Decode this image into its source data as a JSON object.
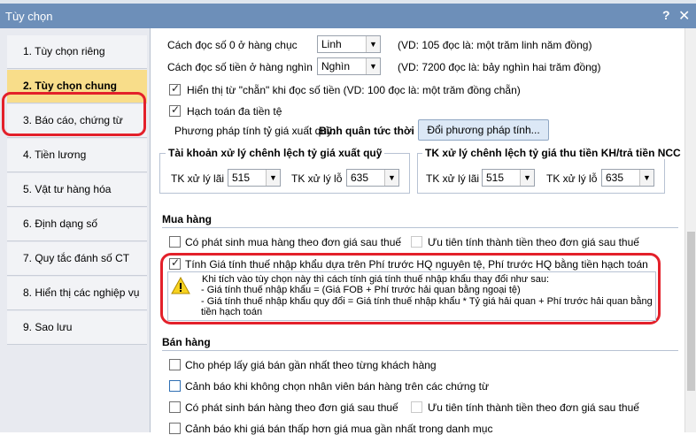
{
  "window": {
    "title": "Tùy chọn",
    "help": "?",
    "close": "✕"
  },
  "sidebar": {
    "items": [
      {
        "label": "1. Tùy chọn riêng"
      },
      {
        "label": "2. Tùy chọn chung"
      },
      {
        "label": "3. Báo cáo, chứng từ"
      },
      {
        "label": "4. Tiền lương"
      },
      {
        "label": "5. Vật tư hàng hóa"
      },
      {
        "label": "6. Định dạng số"
      },
      {
        "label": "7. Quy tắc đánh số CT"
      },
      {
        "label": "8. Hiển thị các nghiệp vụ"
      },
      {
        "label": "9. Sao lưu"
      }
    ]
  },
  "reading": {
    "row1_label": "Cách đọc số 0 ở hàng chục",
    "row1_value": "Linh",
    "row1_example": "(VD: 105 đọc là: một trăm linh năm đồng)",
    "row2_label": "Cách đọc số tiền ở hàng nghìn",
    "row2_value": "Nghìn",
    "row2_example": "(VD: 7200 đọc là: bảy nghìn hai trăm đồng)",
    "show_chan": "Hiển thị từ \"chẵn\" khi đọc số tiền (VD: 100 đọc là: một trăm đồng chẵn)",
    "multi_currency": "Hạch toán đa tiền tệ",
    "rate_method_label": "Phương pháp tính tỷ giá xuất quỹ:",
    "rate_method_value": "Bình quân tức thời",
    "change_method_button": "Đổi phương pháp tính..."
  },
  "group_left": {
    "title": "Tài khoản xử lý chênh lệch tỷ giá xuất quỹ",
    "gain_label": "TK xử lý lãi",
    "gain_value": "515",
    "loss_label": "TK xử lý lỗ",
    "loss_value": "635"
  },
  "group_right": {
    "title": "TK xử lý chênh lệch tỷ giá thu tiền KH/trả tiền NCC",
    "gain_label": "TK xử lý lãi",
    "gain_value": "515",
    "loss_label": "TK xử lý lỗ",
    "loss_value": "635"
  },
  "purchase": {
    "title": "Mua hàng",
    "opt1": "Có phát sinh mua hàng theo đơn giá sau thuế",
    "opt2": "Ưu tiên tính thành tiền theo đơn giá sau thuế",
    "opt3": "Tính Giá tính thuế nhập khẩu dựa trên Phí trước HQ nguyên tệ, Phí trước HQ bằng tiền hạch toán",
    "warn_line1": "Khi tích vào tùy chọn này thì cách tính giá tính thuế nhập khẩu thay đổi như sau:",
    "warn_line2": "- Giá tính thuế nhập khẩu = (Giá FOB + Phí trước hải quan bằng ngoại tệ)",
    "warn_line3": "- Giá tính thuế nhập khẩu quy đổi = Giá tính thuế nhập khẩu * Tỷ giá hải quan + Phí trước hải quan bằng",
    "warn_line4": "tiền hạch toán"
  },
  "sales": {
    "title": "Bán hàng",
    "opt1": "Cho phép lấy giá bán gần nhất theo từng khách hàng",
    "opt2": "Cảnh báo khi không chọn nhân viên bán hàng trên các chứng từ",
    "opt3": "Có phát sinh bán hàng theo đơn giá sau thuế",
    "opt4": "Ưu tiên tính thành tiền theo đơn giá sau thuế",
    "opt5": "Cảnh báo khi giá bán thấp hơn giá mua gần nhất trong danh mục"
  }
}
